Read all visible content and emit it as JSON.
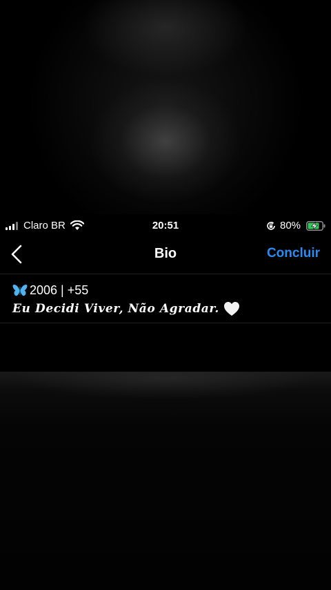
{
  "status_bar": {
    "carrier": "Claro BR",
    "time": "20:51",
    "battery_percent": "80%",
    "battery_level": 0.8,
    "charging": true,
    "icons": [
      "signal-icon",
      "wifi-icon",
      "rotation-lock-icon",
      "battery-charging-icon"
    ]
  },
  "nav": {
    "title": "Bio",
    "back_icon": "chevron-left-icon",
    "done_label": "Concluir"
  },
  "bio": {
    "line1_text": "2006 | +55",
    "line1_icon": "butterfly-icon",
    "line2_text": "Eu Decidi Viver, Não Agradar.",
    "line2_icon": "white-heart-icon"
  },
  "colors": {
    "background": "#000000",
    "accent": "#2a8cf0",
    "butterfly": "#4fb3f0",
    "battery_fill": "#34c759",
    "divider": "#1c1c1e"
  }
}
